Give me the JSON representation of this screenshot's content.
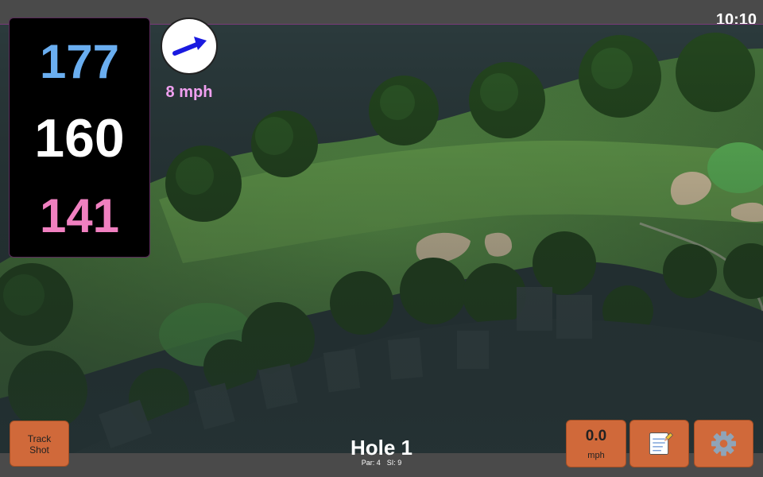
{
  "status": {
    "time": "10:10"
  },
  "yardage": {
    "back": "177",
    "center": "160",
    "front": "141"
  },
  "wind": {
    "speed": "8 mph",
    "icon": "wind-arrow-icon"
  },
  "controls": {
    "track_shot_label": "Track\nShot",
    "speed_value": "0.0",
    "speed_unit": "mph",
    "notes_icon": "notepad-icon",
    "settings_icon": "gear-icon"
  },
  "hole": {
    "title": "Hole 1",
    "par": "Par: 4",
    "si": "SI: 9"
  },
  "colors": {
    "back_distance": "#6aaef0",
    "center_distance": "#ffffff",
    "front_distance": "#f080c0",
    "button": "#d0693a",
    "wind_text": "#f0a0f0"
  }
}
